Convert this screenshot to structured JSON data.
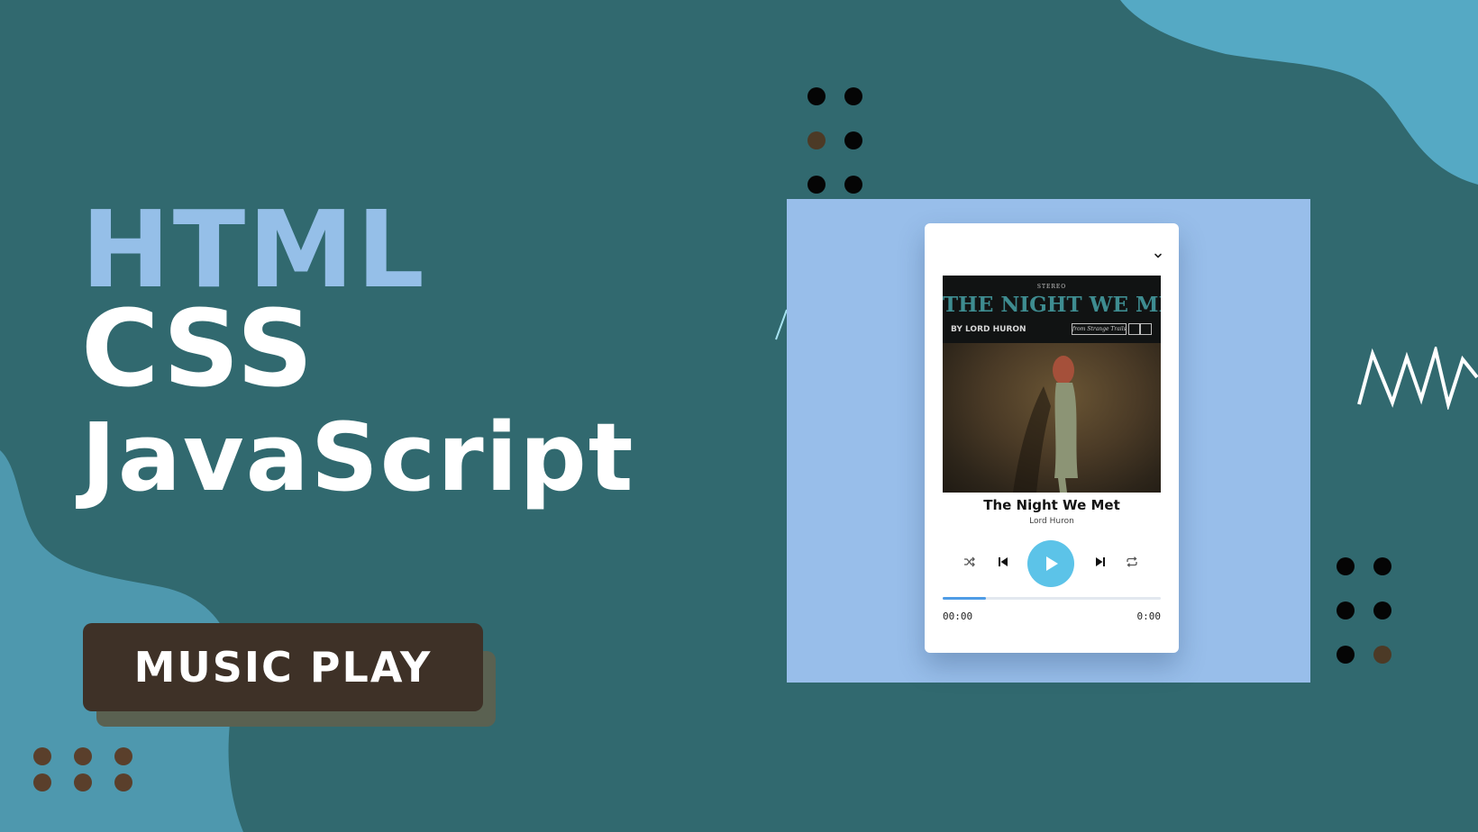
{
  "headline": {
    "line1": "HTML",
    "line2": "CSS",
    "line3": "JavaScript"
  },
  "badge": {
    "label": "MUSIC PLAY"
  },
  "player": {
    "collapse_icon": "chevron-down-icon",
    "album_cover": {
      "top_label": "STEREO",
      "title": "THE NIGHT WE MET",
      "artist_line": "BY LORD HURON",
      "tag": "from Strange Trails"
    },
    "song": {
      "title": "The Night We Met",
      "artist": "Lord Huron"
    },
    "controls": {
      "shuffle": "shuffle-icon",
      "previous": "skip-previous-icon",
      "play": "play-icon",
      "next": "skip-next-icon",
      "repeat": "repeat-icon"
    },
    "progress": {
      "fraction": 0.2
    },
    "time": {
      "current": "00:00",
      "total": "0:00"
    }
  },
  "colors": {
    "background": "#31696f",
    "blob_light_blue": "#4e98ae",
    "blob_top_right": "#55a9c4",
    "headline_accent": "#95bfe8",
    "frame": "#98beea",
    "badge": "#3e3127",
    "badge_shadow": "#5a6151",
    "play_button": "#5cc3e8",
    "progress_fill": "#4f9ce6"
  }
}
